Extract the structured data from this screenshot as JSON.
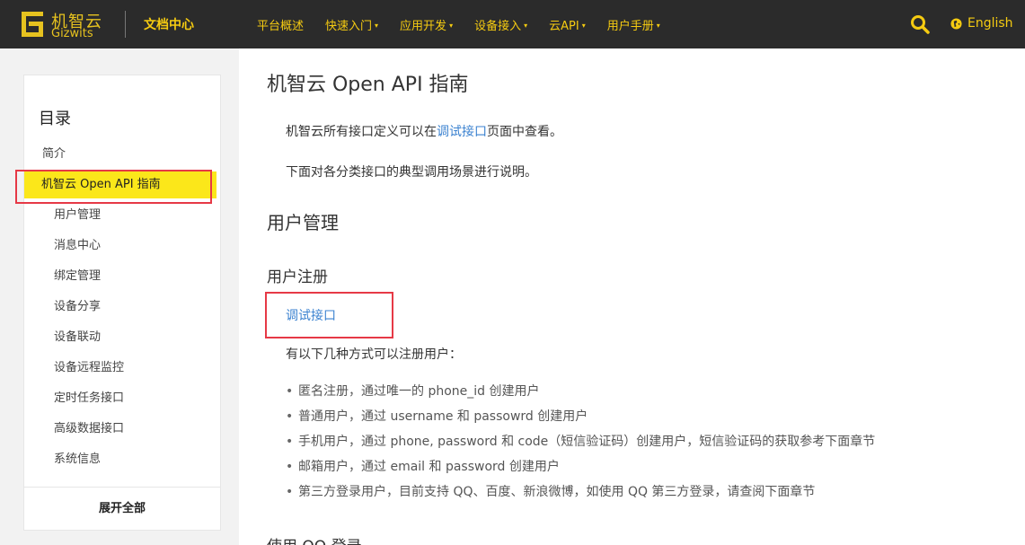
{
  "header": {
    "logo_cn": "机智云",
    "logo_en": "Gizwits",
    "doc_center": "文档中心",
    "nav": [
      {
        "label": "平台概述",
        "has_caret": false
      },
      {
        "label": "快速入门",
        "has_caret": true
      },
      {
        "label": "应用开发",
        "has_caret": true
      },
      {
        "label": "设备接入",
        "has_caret": true
      },
      {
        "label": "云API",
        "has_caret": true
      },
      {
        "label": "用户手册",
        "has_caret": true
      }
    ],
    "caret": "▾",
    "language": "English",
    "icons": {
      "search": "search-icon",
      "globe": "globe-icon"
    },
    "colors": {
      "bar": "#2b2b2b",
      "accent": "#f5cb11"
    }
  },
  "sidebar": {
    "title": "目录",
    "items": [
      {
        "label": "简介",
        "level": 1,
        "active": false
      },
      {
        "label": "机智云 Open API 指南",
        "level": 1,
        "active": true
      },
      {
        "label": "用户管理",
        "level": 2,
        "active": false
      },
      {
        "label": "消息中心",
        "level": 2,
        "active": false
      },
      {
        "label": "绑定管理",
        "level": 2,
        "active": false
      },
      {
        "label": "设备分享",
        "level": 2,
        "active": false
      },
      {
        "label": "设备联动",
        "level": 2,
        "active": false
      },
      {
        "label": "设备远程监控",
        "level": 2,
        "active": false
      },
      {
        "label": "定时任务接口",
        "level": 2,
        "active": false
      },
      {
        "label": "高级数据接口",
        "level": 2,
        "active": false
      },
      {
        "label": "系统信息",
        "level": 2,
        "active": false
      }
    ],
    "expand_all": "展开全部",
    "highlight_color": "#fbe71a"
  },
  "main": {
    "title": "机智云 Open API 指南",
    "intro_prefix": "机智云所有接口定义可以在",
    "intro_link": "调试接口",
    "intro_suffix": "页面中查看。",
    "intro2": "下面对各分类接口的典型调用场景进行说明。",
    "section_title": "用户管理",
    "subsection_title": "用户注册",
    "test_link": "调试接口",
    "register_intro": "有以下几种方式可以注册用户：",
    "bullets": [
      "匿名注册，通过唯一的 phone_id 创建用户",
      "普通用户，通过 username 和 passowrd 创建用户",
      "手机用户，通过 phone, password 和 code（短信验证码）创建用户，短信验证码的获取参考下面章节",
      "邮箱用户，通过 email 和 password 创建用户",
      "第三方登录用户，目前支持 QQ、百度、新浪微博，如使用 QQ 第三方登录，请查阅下面章节"
    ],
    "next_subsection": "使用 QQ 登录",
    "link_color": "#3b82d0",
    "annotation_color": "#e63946"
  }
}
